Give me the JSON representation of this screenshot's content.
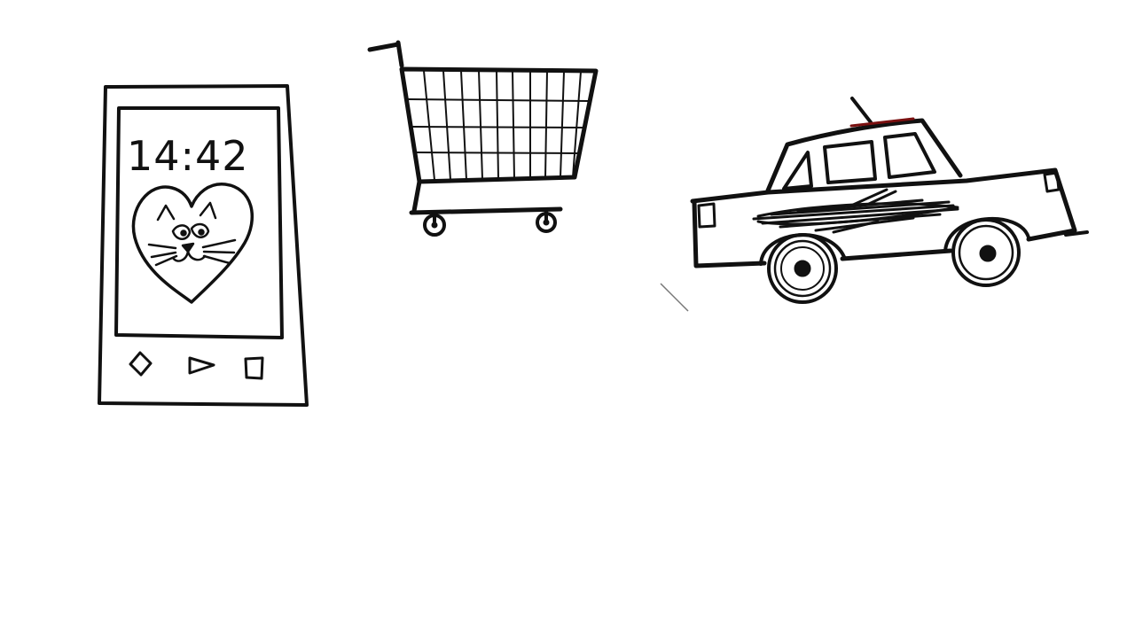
{
  "phone": {
    "clock": "14:42",
    "screen_image": "cat-in-heart",
    "nav_icons": [
      "back-icon",
      "play-icon",
      "square-icon"
    ]
  },
  "shopping_cart": {
    "icon": "shopping-cart-icon"
  },
  "car": {
    "icon": "car-icon"
  },
  "colors": {
    "ink": "#111111",
    "background": "#ffffff",
    "car_roof_accent": "#7a1010"
  }
}
